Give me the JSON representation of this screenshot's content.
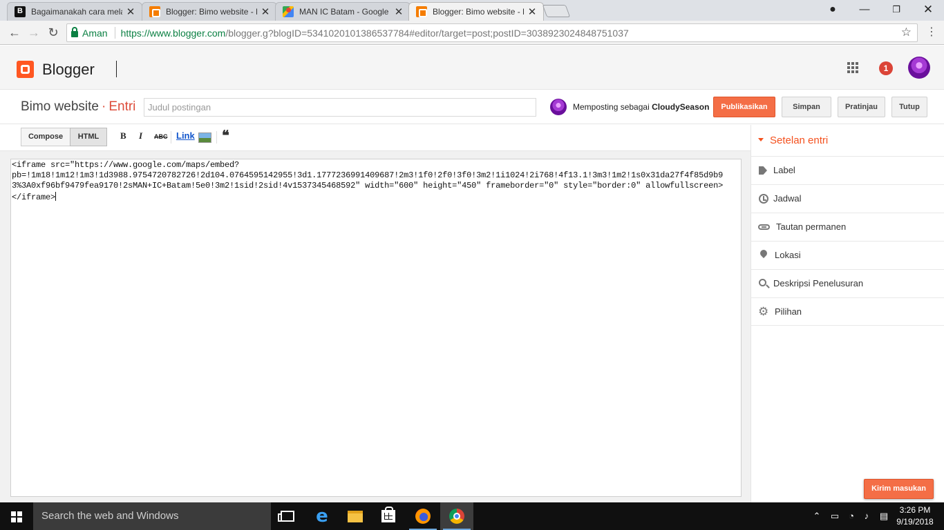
{
  "browser": {
    "tabs": [
      {
        "title": "Bagaimanakah cara mela",
        "favicon": "b-square-icon",
        "active": false
      },
      {
        "title": "Blogger: Bimo website - E",
        "favicon": "blogger-icon",
        "active": false
      },
      {
        "title": "MAN IC Batam - Google",
        "favicon": "google-maps-icon",
        "active": false
      },
      {
        "title": "Blogger: Bimo website - E",
        "favicon": "blogger-icon",
        "active": true
      }
    ],
    "secure_label": "Aman",
    "url_host": "https://www.blogger.com",
    "url_rest": "/blogger.g?blogID=5341020101386537784#editor/target=post;postID=3038923024848751037"
  },
  "header": {
    "app_name": "Blogger",
    "notification_count": "1"
  },
  "post": {
    "blog_name": "Bimo website",
    "separator": "·",
    "section": "Entri",
    "title_placeholder": "Judul postingan",
    "posting_as_prefix": "Memposting sebagai",
    "posting_as_user": "CloudySeason",
    "publish_label": "Publikasikan",
    "save_label": "Simpan",
    "preview_label": "Pratinjau",
    "close_label": "Tutup"
  },
  "editor": {
    "compose_label": "Compose",
    "html_label": "HTML",
    "bold_label": "B",
    "italic_label": "I",
    "strike_label": "ABC",
    "link_label": "Link",
    "quote_label": "❝",
    "code_lines": [
      "<iframe src=\"https://www.google.com/maps/embed?",
      "pb=!1m18!1m12!1m3!1d3988.9754720782726!2d104.0764595142955!3d1.1777236991409687!2m3!1f0!2f0!3f0!3m2!1i1024!2i768!4f13.1!3m3!1m2!1s0x31da27f4f85d9b9",
      "3%3A0xf96bf9479fea9170!2sMAN+IC+Batam!5e0!3m2!1sid!2sid!4v1537345468592\" width=\"600\" height=\"450\" frameborder=\"0\" style=\"border:0\" allowfullscreen>",
      "</iframe>"
    ]
  },
  "settings": {
    "heading": "Setelan entri",
    "items": [
      {
        "label": "Label",
        "icon": "tag-icon"
      },
      {
        "label": "Jadwal",
        "icon": "clock-icon"
      },
      {
        "label": "Tautan permanen",
        "icon": "link-icon"
      },
      {
        "label": "Lokasi",
        "icon": "location-pin-icon"
      },
      {
        "label": "Deskripsi Penelusuran",
        "icon": "search-icon"
      },
      {
        "label": "Pilihan",
        "icon": "gear-icon"
      }
    ]
  },
  "feedback_label": "Kirim masukan",
  "taskbar": {
    "search_placeholder": "Search the web and Windows",
    "time": "3:26 PM",
    "date": "9/19/2018"
  },
  "colors": {
    "brand_orange": "#f46e46",
    "entry_red": "#dd4b39",
    "secure_green": "#0b8043"
  }
}
